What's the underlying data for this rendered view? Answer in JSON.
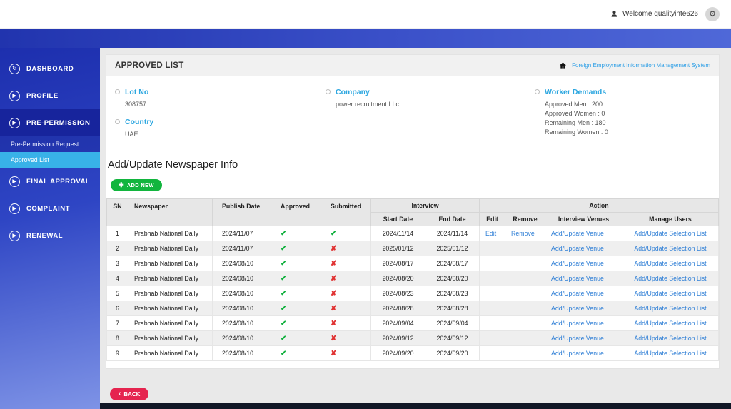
{
  "topbar": {
    "welcome": "Welcome qualityinte626"
  },
  "sidebar": {
    "items": [
      {
        "label": "DASHBOARD"
      },
      {
        "label": "PROFILE"
      },
      {
        "label": "PRE-PERMISSION"
      },
      {
        "label": "FINAL APPROVAL"
      },
      {
        "label": "COMPLAINT"
      },
      {
        "label": "RENEWAL"
      }
    ],
    "submenu": [
      {
        "label": "Pre-Permission Request"
      },
      {
        "label": "Approved List"
      }
    ]
  },
  "header": {
    "title": "APPROVED LIST",
    "breadcrumb": "Foreign Employment Information Management System"
  },
  "info": {
    "lot_no": {
      "label": "Lot No",
      "value": "308757"
    },
    "country": {
      "label": "Country",
      "value": "UAE"
    },
    "company": {
      "label": "Company",
      "value": "power recruitment LLc"
    },
    "worker_demands": {
      "label": "Worker Demands",
      "line1": "Approved Men : 200",
      "line2": "Approved Women : 0",
      "line3": "Remaining Men : 180",
      "line4": "Remaining Women : 0"
    }
  },
  "content": {
    "section_title": "Add/Update Newspaper Info",
    "add_new_label": "ADD NEW",
    "back_label": "BACK"
  },
  "table": {
    "headers": {
      "sn": "SN",
      "newspaper": "Newspaper",
      "publish_date": "Publish Date",
      "approved": "Approved",
      "submitted": "Submitted",
      "interview": "Interview",
      "action": "Action",
      "start_date": "Start Date",
      "end_date": "End Date",
      "edit": "Edit",
      "remove": "Remove",
      "interview_venues": "Interview Venues",
      "manage_users": "Manage Users"
    },
    "rows": [
      {
        "sn": "1",
        "newspaper": "Prabhab National Daily",
        "publish_date": "2024/11/07",
        "approved": true,
        "submitted": true,
        "start_date": "2024/11/14",
        "end_date": "2024/11/14",
        "edit": "Edit",
        "remove": "Remove",
        "interview_venues": "Add/Update Venue",
        "manage_users": "Add/Update Selection List"
      },
      {
        "sn": "2",
        "newspaper": "Prabhab National Daily",
        "publish_date": "2024/11/07",
        "approved": true,
        "submitted": false,
        "start_date": "2025/01/12",
        "end_date": "2025/01/12",
        "edit": "",
        "remove": "",
        "interview_venues": "Add/Update Venue",
        "manage_users": "Add/Update Selection List"
      },
      {
        "sn": "3",
        "newspaper": "Prabhab National Daily",
        "publish_date": "2024/08/10",
        "approved": true,
        "submitted": false,
        "start_date": "2024/08/17",
        "end_date": "2024/08/17",
        "edit": "",
        "remove": "",
        "interview_venues": "Add/Update Venue",
        "manage_users": "Add/Update Selection List"
      },
      {
        "sn": "4",
        "newspaper": "Prabhab National Daily",
        "publish_date": "2024/08/10",
        "approved": true,
        "submitted": false,
        "start_date": "2024/08/20",
        "end_date": "2024/08/20",
        "edit": "",
        "remove": "",
        "interview_venues": "Add/Update Venue",
        "manage_users": "Add/Update Selection List"
      },
      {
        "sn": "5",
        "newspaper": "Prabhab National Daily",
        "publish_date": "2024/08/10",
        "approved": true,
        "submitted": false,
        "start_date": "2024/08/23",
        "end_date": "2024/08/23",
        "edit": "",
        "remove": "",
        "interview_venues": "Add/Update Venue",
        "manage_users": "Add/Update Selection List"
      },
      {
        "sn": "6",
        "newspaper": "Prabhab National Daily",
        "publish_date": "2024/08/10",
        "approved": true,
        "submitted": false,
        "start_date": "2024/08/28",
        "end_date": "2024/08/28",
        "edit": "",
        "remove": "",
        "interview_venues": "Add/Update Venue",
        "manage_users": "Add/Update Selection List"
      },
      {
        "sn": "7",
        "newspaper": "Prabhab National Daily",
        "publish_date": "2024/08/10",
        "approved": true,
        "submitted": false,
        "start_date": "2024/09/04",
        "end_date": "2024/09/04",
        "edit": "",
        "remove": "",
        "interview_venues": "Add/Update Venue",
        "manage_users": "Add/Update Selection List"
      },
      {
        "sn": "8",
        "newspaper": "Prabhab National Daily",
        "publish_date": "2024/08/10",
        "approved": true,
        "submitted": false,
        "start_date": "2024/09/12",
        "end_date": "2024/09/12",
        "edit": "",
        "remove": "",
        "interview_venues": "Add/Update Venue",
        "manage_users": "Add/Update Selection List"
      },
      {
        "sn": "9",
        "newspaper": "Prabhab National Daily",
        "publish_date": "2024/08/10",
        "approved": true,
        "submitted": false,
        "start_date": "2024/09/20",
        "end_date": "2024/09/20",
        "edit": "",
        "remove": "",
        "interview_venues": "Add/Update Venue",
        "manage_users": "Add/Update Selection List"
      }
    ]
  },
  "colors": {
    "accent_blue": "#2da7e0",
    "link_blue": "#2f7fd6",
    "success_green": "#12b53e",
    "danger_red": "#e5244f",
    "sidebar_selected": "#38b2e8"
  }
}
